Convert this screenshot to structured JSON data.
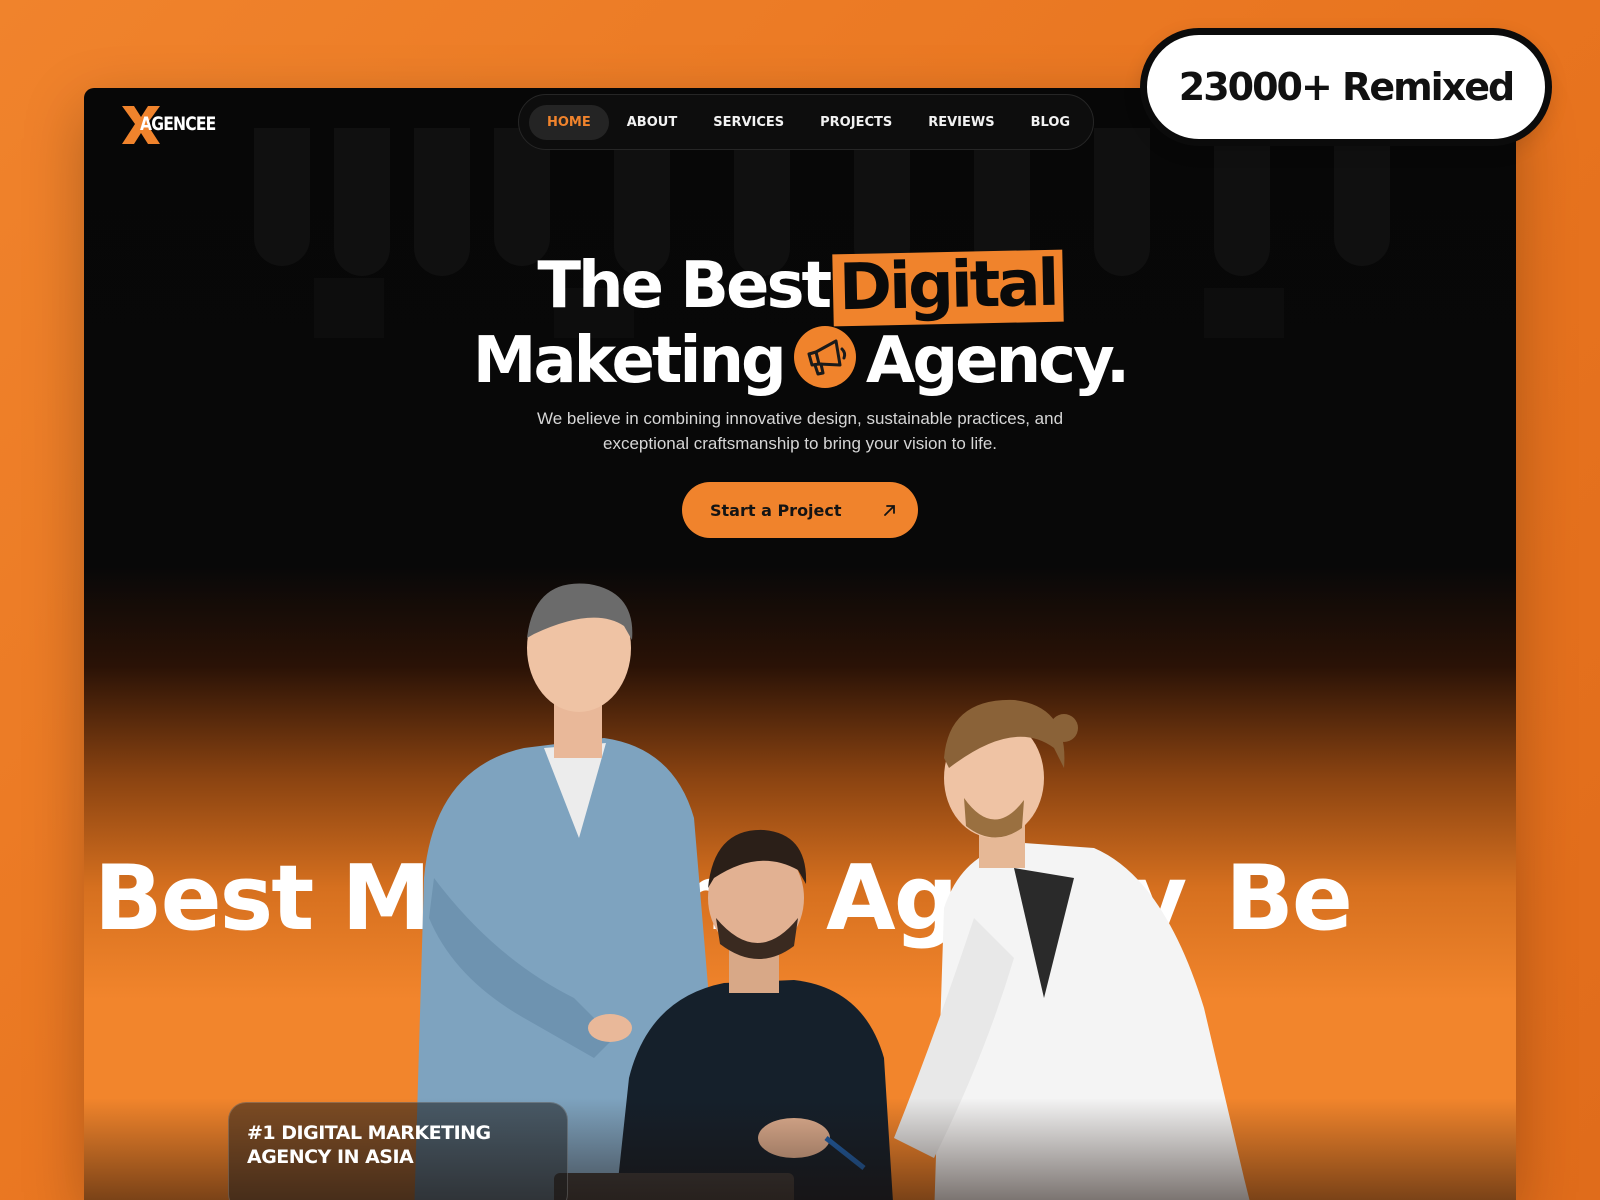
{
  "badge": {
    "text": "23000+ Remixed"
  },
  "brand": {
    "logo_text": "AGENCEE"
  },
  "nav": {
    "items": [
      {
        "label": "HOME",
        "active": true
      },
      {
        "label": "ABOUT",
        "active": false
      },
      {
        "label": "SERVICES",
        "active": false
      },
      {
        "label": "PROJECTS",
        "active": false
      },
      {
        "label": "REVIEWS",
        "active": false
      },
      {
        "label": "BLOG",
        "active": false
      }
    ]
  },
  "hero": {
    "line1_prefix": "The Best",
    "line1_highlight": "Digital",
    "line2_word1": "Maketing",
    "line2_word2": "Agency.",
    "subtitle_line1": "We believe in combining innovative design, sustainable practices, and",
    "subtitle_line2": "exceptional craftsmanship to bring your vision to life.",
    "cta_label": "Start a Project",
    "icon": "megaphone-icon"
  },
  "marquee": {
    "text": "Best Maketing Agency",
    "repeat_tail": "Be"
  },
  "tagline": {
    "line1": "#1 DIGITAL MARKETING",
    "line2": "AGENCY IN ASIA"
  },
  "colors": {
    "accent": "#f0832c",
    "dark": "#070707",
    "background": "#ea7a24"
  }
}
